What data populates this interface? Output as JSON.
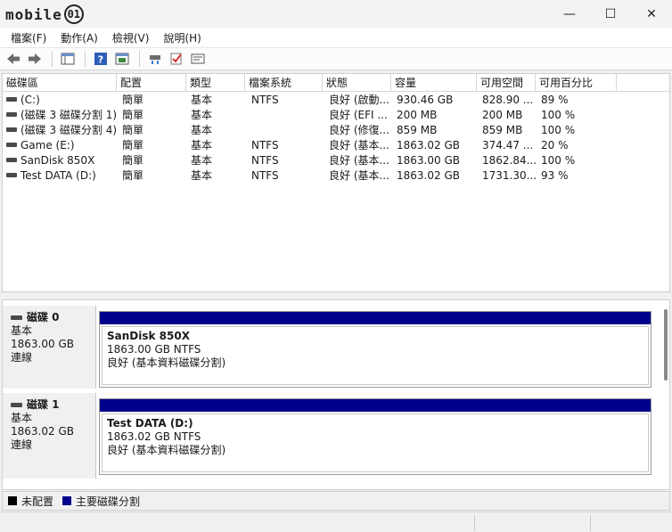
{
  "titlebar": {
    "logo_text": "mobile",
    "logo_badge": "01",
    "minimize": "—",
    "maximize": "☐",
    "close": "✕"
  },
  "menu": [
    {
      "label": "檔案(F)"
    },
    {
      "label": "動作(A)"
    },
    {
      "label": "檢視(V)"
    },
    {
      "label": "說明(H)"
    }
  ],
  "toolbar": {
    "back_icon": "arrow-left-icon",
    "forward_icon": "arrow-right-icon",
    "console_tree_icon": "console-tree-icon",
    "help_icon": "help-icon",
    "properties_icon": "properties-icon",
    "connect_icon": "connect-disk-icon",
    "check_icon": "check-icon",
    "settings_icon": "settings-icon"
  },
  "table": {
    "headers": [
      "磁碟區",
      "配置",
      "類型",
      "檔案系統",
      "狀態",
      "容量",
      "可用空間",
      "可用百分比"
    ],
    "rows": [
      [
        "(C:)",
        "簡單",
        "基本",
        "NTFS",
        "良好 (啟動...",
        "930.46 GB",
        "828.90 ...",
        "89 %"
      ],
      [
        "(磁碟 3 磁碟分割 1)",
        "簡單",
        "基本",
        "",
        "良好 (EFI ...",
        "200 MB",
        "200 MB",
        "100 %"
      ],
      [
        "(磁碟 3 磁碟分割 4)",
        "簡單",
        "基本",
        "",
        "良好 (修復...",
        "859 MB",
        "859 MB",
        "100 %"
      ],
      [
        "Game (E:)",
        "簡單",
        "基本",
        "NTFS",
        "良好 (基本...",
        "1863.02 GB",
        "374.47 ...",
        "20 %"
      ],
      [
        "SanDisk 850X",
        "簡單",
        "基本",
        "NTFS",
        "良好 (基本...",
        "1863.00 GB",
        "1862.84...",
        "100 %"
      ],
      [
        "Test DATA (D:)",
        "簡單",
        "基本",
        "NTFS",
        "良好 (基本...",
        "1863.02 GB",
        "1731.30...",
        "93 %"
      ]
    ]
  },
  "disks": [
    {
      "name": "磁碟 0",
      "type": "基本",
      "size": "1863.00 GB",
      "status": "連線",
      "partition": {
        "name": "SanDisk 850X",
        "size_fs": "1863.00 GB NTFS",
        "status": "良好 (基本資料磁碟分割)"
      }
    },
    {
      "name": "磁碟 1",
      "type": "基本",
      "size": "1863.02 GB",
      "status": "連線",
      "partition": {
        "name": "Test DATA  (D:)",
        "size_fs": "1863.02 GB NTFS",
        "status": "良好 (基本資料磁碟分割)"
      }
    }
  ],
  "legend": {
    "unallocated": "未配置",
    "primary": "主要磁碟分割",
    "unallocated_color": "#000000",
    "primary_color": "#00008b"
  }
}
